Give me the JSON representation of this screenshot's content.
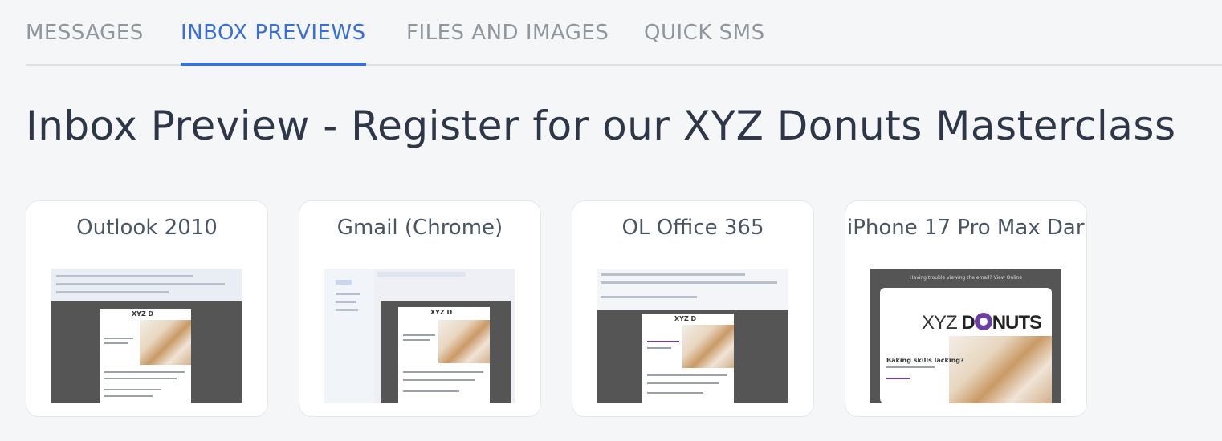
{
  "tabs": [
    {
      "label": "MESSAGES",
      "active": false
    },
    {
      "label": "INBOX PREVIEWS",
      "active": true
    },
    {
      "label": "FILES AND IMAGES",
      "active": false
    },
    {
      "label": "QUICK SMS",
      "active": false
    }
  ],
  "page_title": "Inbox Preview - Register for our XYZ Donuts Masterclass",
  "previews": [
    {
      "client": "Outlook 2010"
    },
    {
      "client": "Gmail (Chrome)"
    },
    {
      "client": "OL Office 365"
    },
    {
      "client": "iPhone 17 Pro Max Dar"
    }
  ],
  "iphone_preview": {
    "header_text": "Having trouble viewing the email? View Online",
    "logo_left": "XYZ ",
    "logo_right": "DNUTS",
    "headline": "Baking skills lacking?"
  },
  "colors": {
    "accent": "#3b6fd8",
    "brand_purple": "#6a3fa0"
  }
}
